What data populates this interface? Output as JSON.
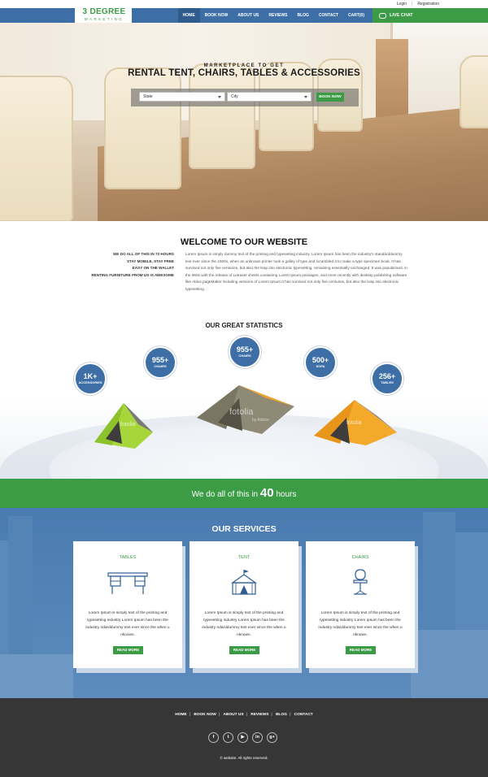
{
  "toplinks": {
    "login": "Login",
    "separator": "|",
    "registration": "Registration"
  },
  "logo": {
    "line1": "3 DEGREE",
    "line2": "MARKETING"
  },
  "nav": {
    "items": [
      "HOME",
      "BOOK NOW",
      "ABOUT US",
      "REVIEWS",
      "BLOG",
      "CONTACT",
      "CART(0)"
    ],
    "live_chat": "LIVE CHAT"
  },
  "hero": {
    "subtitle": "MARKETPLACE TO GET",
    "title": "RENTAL TENT, CHAIRS, TABLES & ACCESSORIES",
    "state_select": "State",
    "city_select": "City",
    "book_button": "BOOK NOW"
  },
  "welcome": {
    "title": "WELCOME TO OUR WEBSITE",
    "bullets": [
      "WE DO ALL OF THIS IN 72 HOURS",
      "STAY MOBILE, STAY FREE",
      "EASY ON THE WALLET",
      "RENTING FURNITURE FROM US IS AWESOME"
    ],
    "text": "Lorem Ipsum is simply dummy text of the printing and typesetting industry. Lorem Ipsum has been the industry's standarddummy text ever since the 1500s, when an unknown printer took a galley of type and scrambled it to make a type specimen book. It has survived not only five centuries, but also the leap into electronic typesetting, remaining essentially unchanged. It was popularised. in the 960s with the release of Letraset sheets containing Lorem Ipsum passages, and more recently with desktop publishing software like Aldus pageMaker including versions of Lorem Ipsum.It has survived not only five centuries, but also the leap into electronic typesetting."
  },
  "stats": {
    "title": "OUR GREAT STATISTICS",
    "items": [
      {
        "value": "1K+",
        "label": "ACCESSORIES"
      },
      {
        "value": "955+",
        "label": "CHAIRS"
      },
      {
        "value": "955+",
        "label": "CHAIRS"
      },
      {
        "value": "500+",
        "label": "SOFA"
      },
      {
        "value": "256+",
        "label": "TABLES"
      }
    ],
    "watermark": "fotolia",
    "watermark_sub": "by Adobe"
  },
  "band": {
    "prefix": "We do all of this in",
    "number": "40",
    "suffix": "hours"
  },
  "services": {
    "title": "OUR SERVICES",
    "cards": [
      {
        "title": "TABLES",
        "text": "Lorem Ipsum is simply text of the printing and typesetting industry Lorem Ipsum has been the industry ndarddummy text ever since the when u nknown.",
        "button": "READ MORE",
        "icon": "table-icon"
      },
      {
        "title": "TENT",
        "text": "Lorem Ipsum is simply text of the printing and typesetting industry Lorem Ipsum has been the industry ndarddummy text ever since the when u nknown.",
        "button": "READ MORE",
        "icon": "tent-icon"
      },
      {
        "title": "CHAIRS",
        "text": "Lorem Ipsum is simply text of the printing and typesetting industry Lorem Ipsum has been the industry ndarddummy text ever since the when u nknown.",
        "button": "READ MORE",
        "icon": "chair-icon"
      }
    ]
  },
  "footer": {
    "links": [
      "HOME",
      "BOOK NOW",
      "ABOUT US",
      "REVIEWS",
      "BLOG",
      "CONTACT"
    ],
    "social": [
      {
        "name": "facebook-icon",
        "glyph": "f"
      },
      {
        "name": "twitter-icon",
        "glyph": "t"
      },
      {
        "name": "youtube-icon",
        "glyph": "▶"
      },
      {
        "name": "linkedin-icon",
        "glyph": "in"
      },
      {
        "name": "googleplus-icon",
        "glyph": "g+"
      }
    ],
    "copyright": "© website. All rights reserved."
  },
  "colors": {
    "blue": "#3d6fa6",
    "green": "#3b9c45",
    "footer": "#363636"
  }
}
